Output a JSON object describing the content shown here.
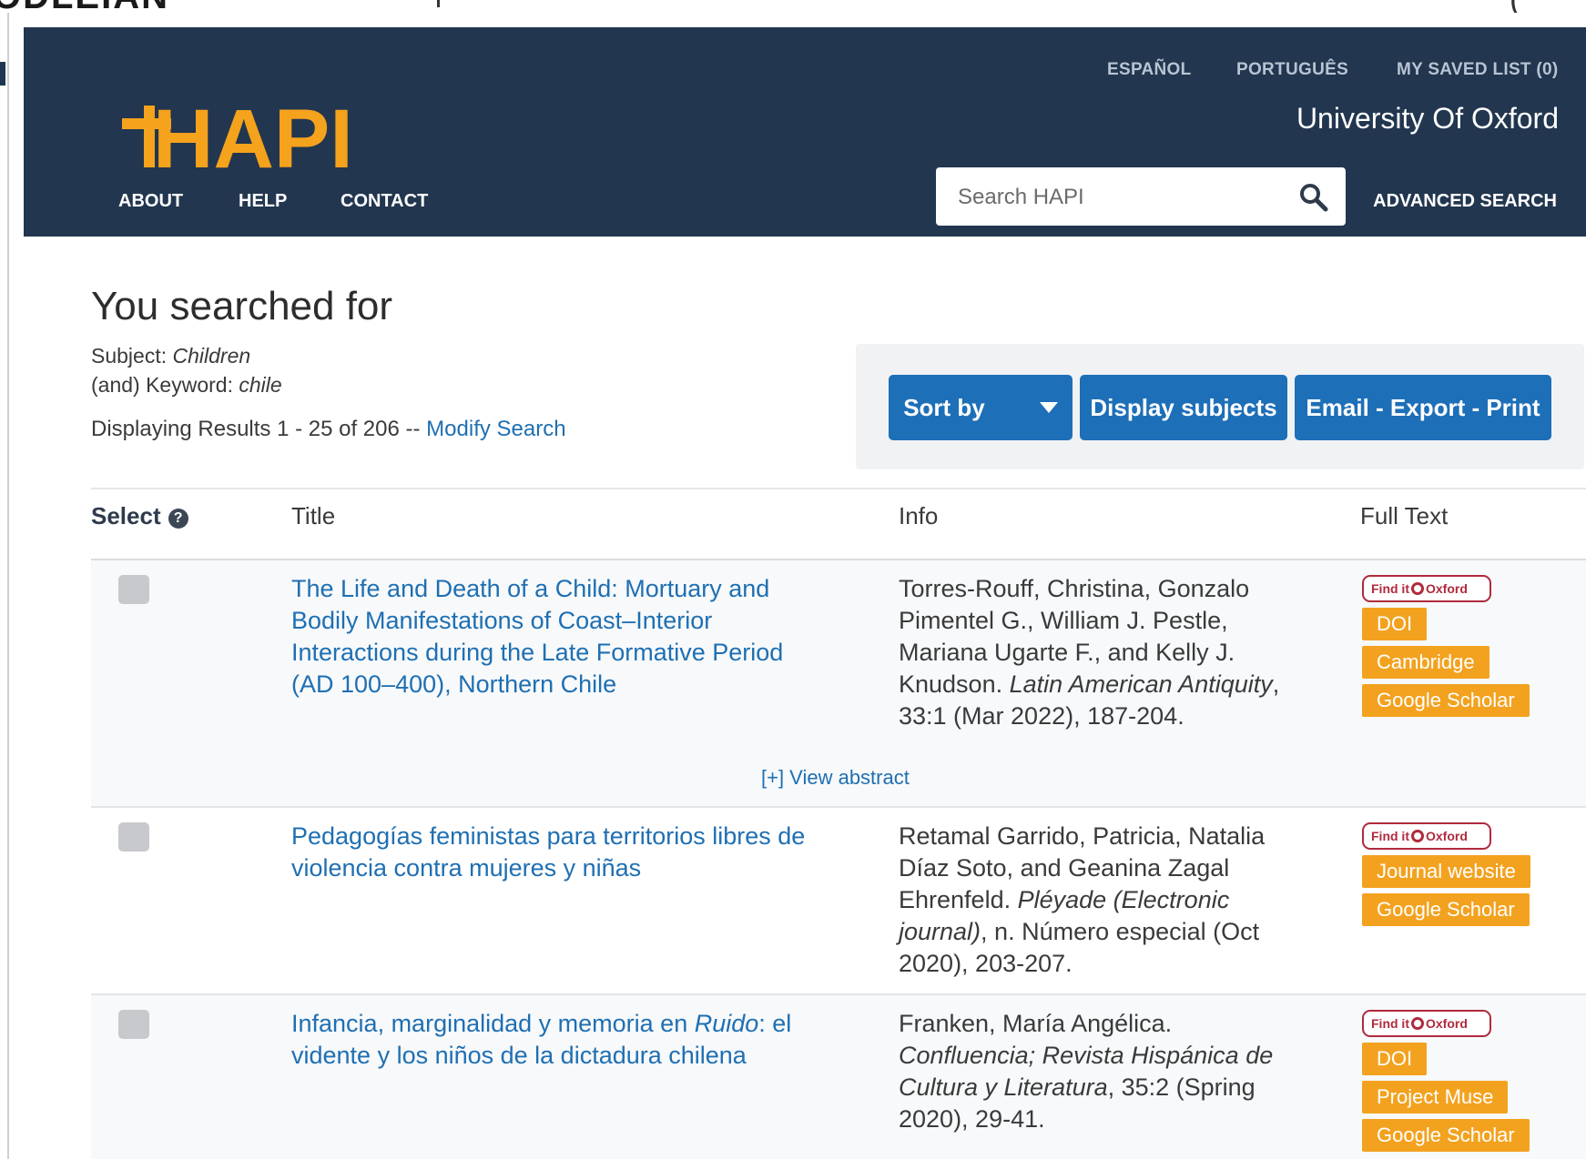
{
  "header": {
    "utility_links": [
      "ESPAÑOL",
      "PORTUGUÊS",
      "MY SAVED LIST (0)"
    ],
    "institution": "University Of Oxford",
    "logo_text": "HAPI",
    "nav": [
      "ABOUT",
      "HELP",
      "CONTACT"
    ],
    "search_placeholder": "Search HAPI",
    "advanced_search": "ADVANCED SEARCH"
  },
  "summary": {
    "heading": "You searched for",
    "subject_label": "Subject: ",
    "subject_value": "Children",
    "keyword_label": "(and) Keyword: ",
    "keyword_value": "chile",
    "results_text": "Displaying Results 1 - 25 of 206 -- ",
    "modify_search": "Modify Search"
  },
  "toolbar": {
    "sort_by": "Sort by",
    "display_subjects": "Display subjects",
    "email_export_print": "Email - Export - Print"
  },
  "table": {
    "headers": {
      "select": "Select",
      "title": "Title",
      "info": "Info",
      "full_text": "Full Text"
    },
    "view_abstract": "[+] View abstract",
    "findit_label": "Find it",
    "findit_brand": "Oxford",
    "rows": [
      {
        "title": "The Life and Death of a Child: Mortuary and Bodily Manifestations of Coast–Interior Interactions during the Late Formative Period (AD 100–400), Northern Chile",
        "authors": "Torres-Rouff, Christina, Gonzalo Pimentel G., William J. Pestle, Mariana Ugarte F., and Kelly J. Knudson. ",
        "journal": "Latin American Antiquity",
        "citation": ", 33:1 (Mar 2022), 187-204.",
        "links": [
          "DOI",
          "Cambridge",
          "Google Scholar"
        ]
      },
      {
        "title": "Pedagogías feministas para territorios libres de violencia contra mujeres y niñas",
        "authors": "Retamal Garrido, Patricia, Natalia Díaz Soto, and Geanina Zagal Ehrenfeld. ",
        "journal": "Pléyade (Electronic journal)",
        "citation": ", n. Número especial (Oct 2020), 203-207.",
        "links": [
          "Journal website",
          "Google Scholar"
        ]
      },
      {
        "title_pre": "Infancia, marginalidad y memoria en ",
        "title_em": "Ruido",
        "title_post": ": el vidente y los niños de la dictadura chilena",
        "authors": "Franken, María Angélica. ",
        "journal": "Confluencia; Revista Hispánica de Cultura y Literatura",
        "citation": ", 35:2 (Spring 2020), 29-41.",
        "links": [
          "DOI",
          "Project Muse",
          "Google Scholar"
        ]
      }
    ]
  },
  "colors": {
    "header_bg": "#22364f",
    "logo_orange": "#f5a21c",
    "button_blue": "#1d6fb8",
    "link_blue": "#1f6fb2",
    "badge_orange": "#f3a21f",
    "findit_red": "#b02a3d"
  },
  "icons": [
    "search-icon",
    "help-icon",
    "chevron-down-icon"
  ]
}
